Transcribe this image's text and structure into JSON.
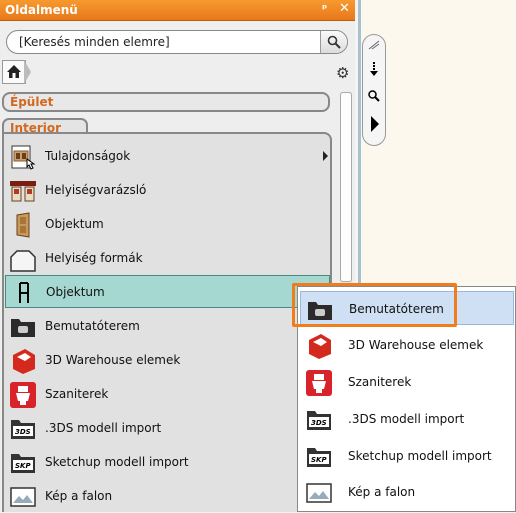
{
  "panel": {
    "title": "Oldalmenü",
    "pin_glyph": "ᵖ",
    "close_glyph": "✕",
    "search_placeholder": "[Keresés minden elemre]",
    "categories": {
      "epulet": "Épület",
      "interior": "Interior"
    },
    "items": [
      {
        "label": "Tulajdonságok",
        "icon": "properties-icon",
        "has_submenu": true
      },
      {
        "label": "Helyiségvarázsló",
        "icon": "room-wizard-icon"
      },
      {
        "label": "Objektum",
        "icon": "door-object-icon"
      },
      {
        "label": "Helyiség formák",
        "icon": "room-shape-icon"
      },
      {
        "label": "Objektum",
        "icon": "chair-icon",
        "selected": true
      },
      {
        "label": "Bemutatóterem",
        "icon": "showroom-folder-icon"
      },
      {
        "label": "3D Warehouse elemek",
        "icon": "warehouse-icon"
      },
      {
        "label": "Szaniterek",
        "icon": "toilet-icon"
      },
      {
        "label": ".3DS modell import",
        "icon": "3ds-import-icon"
      },
      {
        "label": "Sketchup modell import",
        "icon": "skp-import-icon"
      },
      {
        "label": "Kép a falon",
        "icon": "picture-on-wall-icon"
      }
    ]
  },
  "submenu": {
    "items": [
      {
        "label": "Bemutatóterem",
        "icon": "showroom-folder-icon",
        "highlighted": true
      },
      {
        "label": "3D Warehouse elemek",
        "icon": "warehouse-icon"
      },
      {
        "label": "Szaniterek",
        "icon": "toilet-icon"
      },
      {
        "label": ".3DS modell import",
        "icon": "3ds-import-icon"
      },
      {
        "label": "Sketchup modell import",
        "icon": "skp-import-icon"
      },
      {
        "label": "Kép a falon",
        "icon": "picture-on-wall-icon"
      }
    ]
  },
  "colors": {
    "title_bar": "#f08a24",
    "category_text": "#d2691e",
    "selected_row": "#a4d8d1",
    "highlight_frame": "#f07c1b"
  }
}
